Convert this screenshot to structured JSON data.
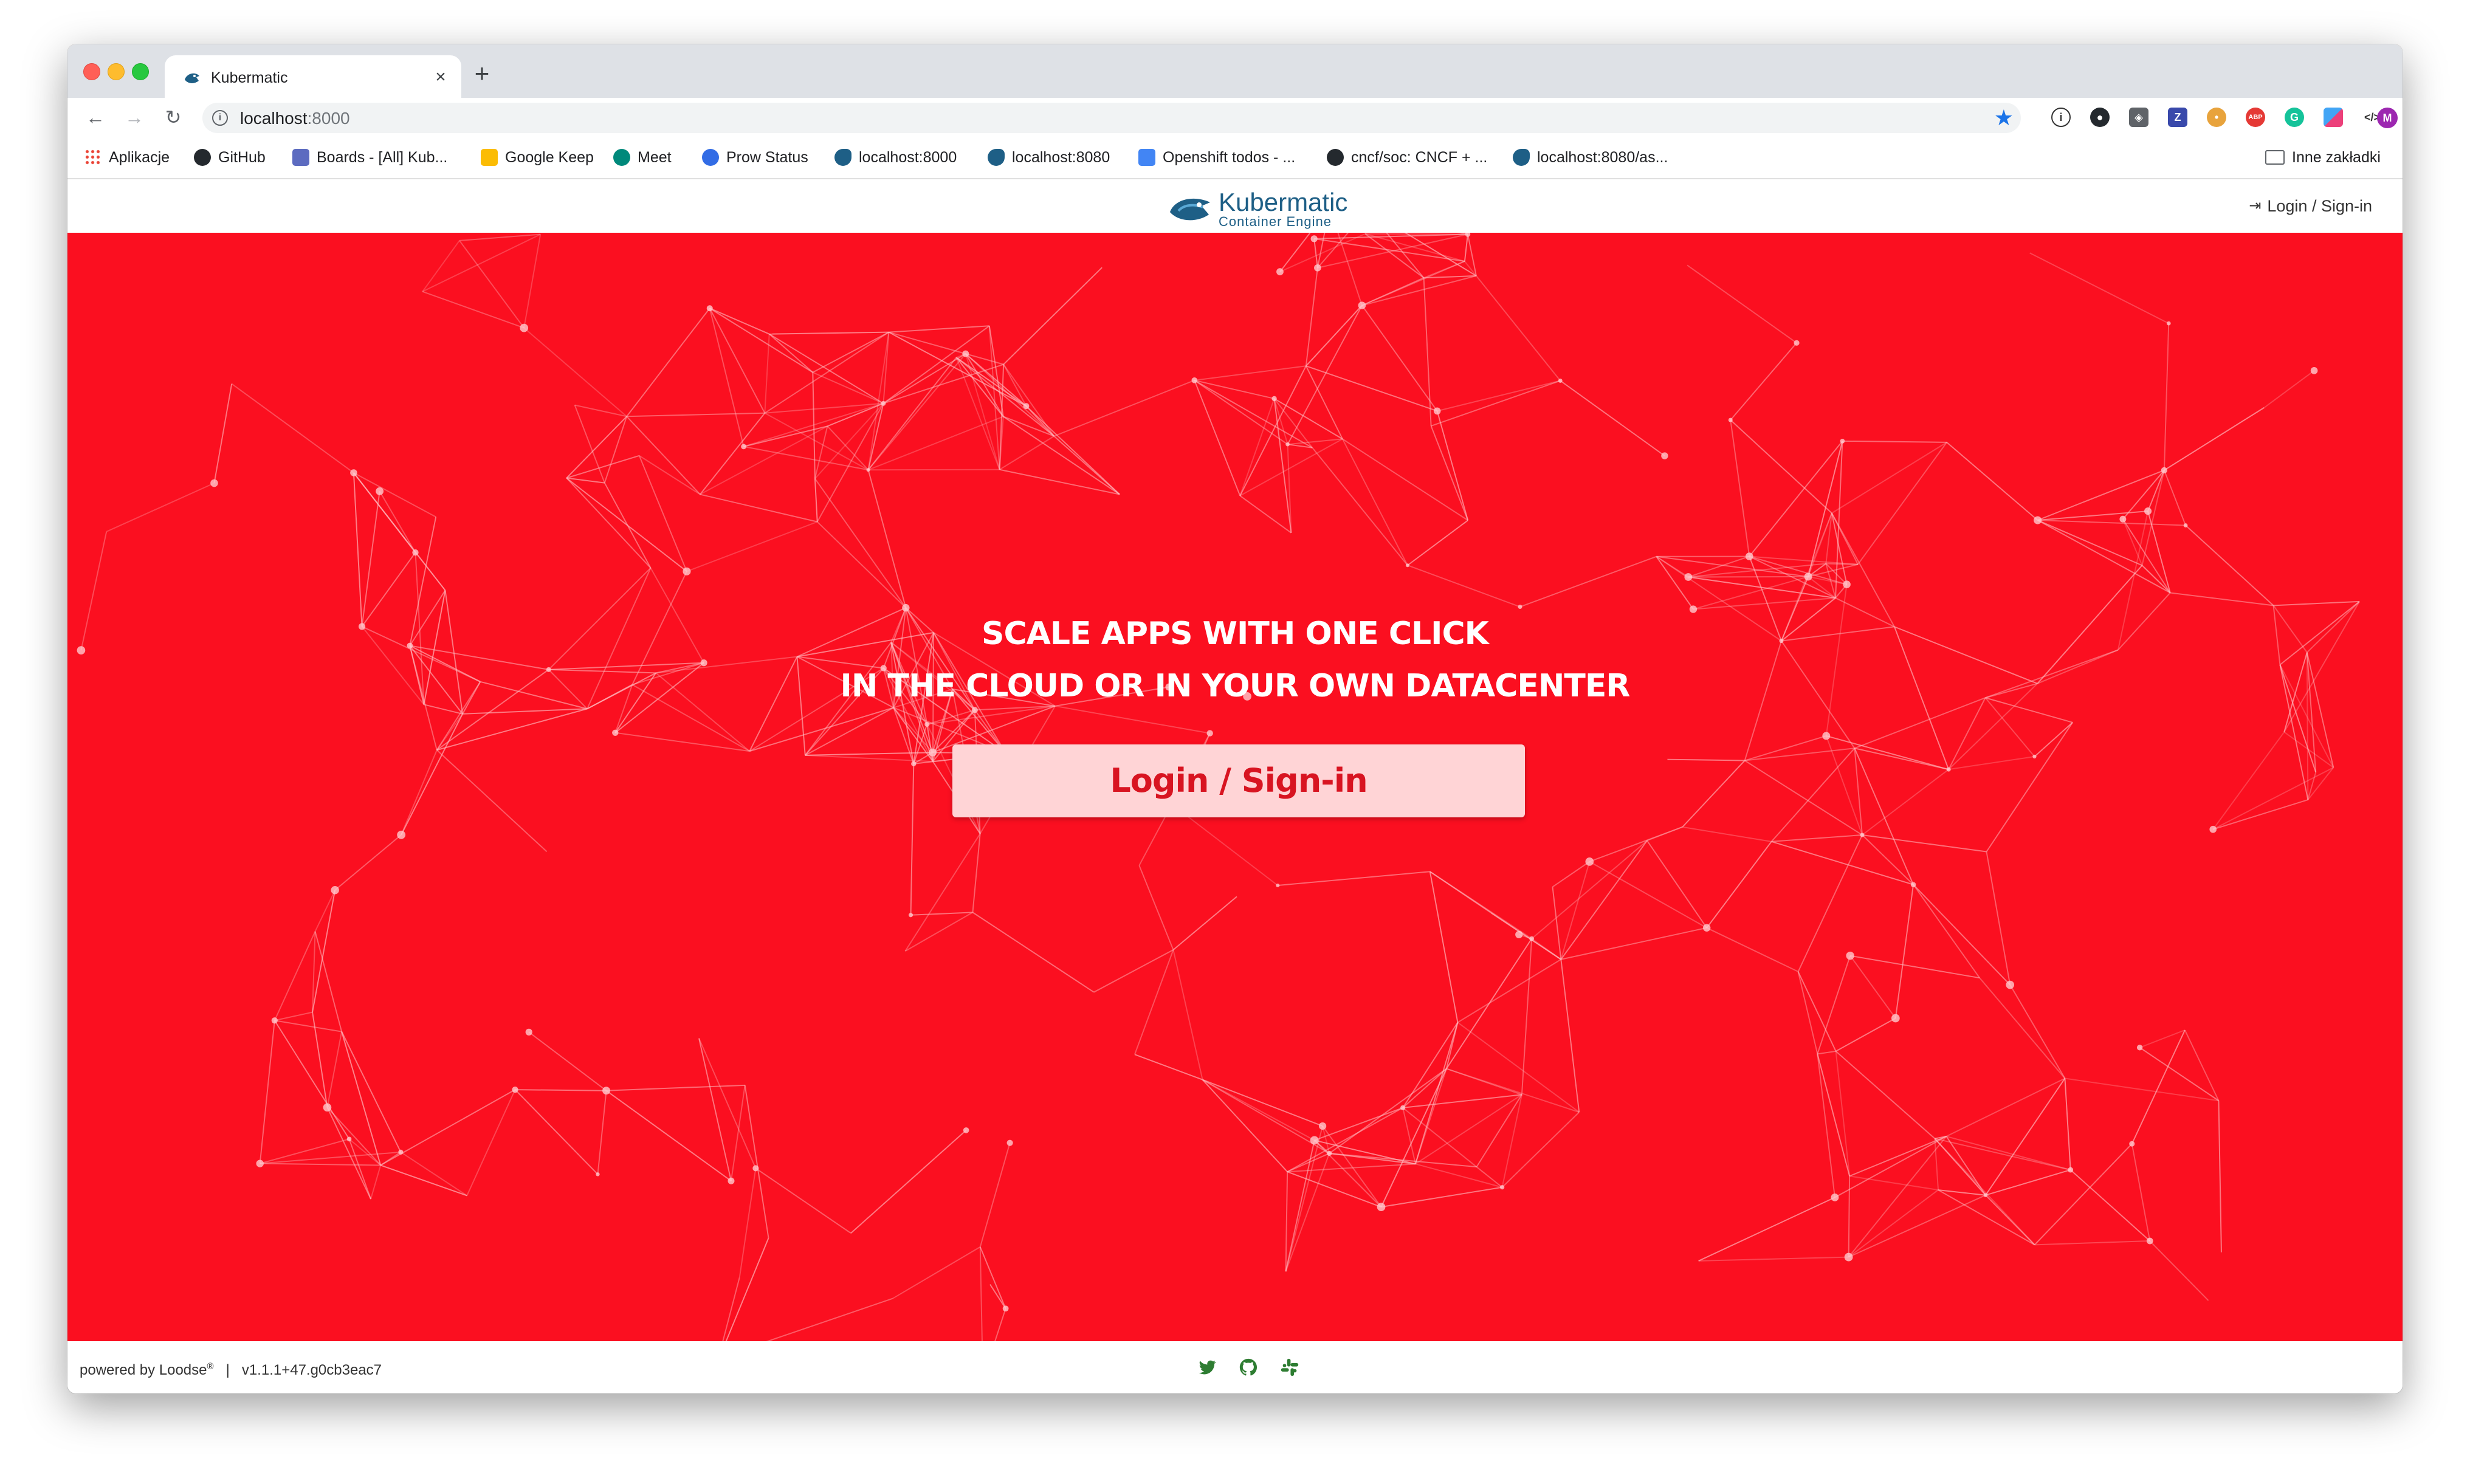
{
  "browser": {
    "tab_title": "Kubermatic",
    "url_host": "localhost",
    "url_port": ":8000",
    "extensions": [
      "1password-icon",
      "github-icon",
      "extension-icon",
      "zotero-icon",
      "cookie-icon",
      "adblock-icon",
      "grammarly-icon",
      "extension-icon",
      "code-icon"
    ],
    "profile_initial": "M",
    "bookmarks": [
      {
        "label": "Aplikacje",
        "icon": "apps-grid-icon"
      },
      {
        "label": "GitHub",
        "icon": "github-icon"
      },
      {
        "label": "Boards - [All] Kub...",
        "icon": "zenhub-icon"
      },
      {
        "label": "Google Keep",
        "icon": "keep-icon"
      },
      {
        "label": "Meet",
        "icon": "meet-icon"
      },
      {
        "label": "Prow Status",
        "icon": "kubernetes-icon"
      },
      {
        "label": "localhost:8000",
        "icon": "kubermatic-icon"
      },
      {
        "label": "localhost:8080",
        "icon": "kubermatic-icon"
      },
      {
        "label": "Openshift todos - ...",
        "icon": "docs-icon"
      },
      {
        "label": "cncf/soc: CNCF + ...",
        "icon": "github-icon"
      },
      {
        "label": "localhost:8080/as...",
        "icon": "kubermatic-icon"
      }
    ],
    "other_bookmarks": "Inne zakładki"
  },
  "header": {
    "brand_name": "Kubermatic",
    "brand_sub": "Container Engine",
    "login_label": "Login / Sign-in"
  },
  "hero": {
    "headline_1": "SCALE APPS WITH ONE CLICK",
    "headline_2": "IN THE CLOUD OR IN YOUR OWN DATACENTER",
    "cta_label": "Login / Sign-in",
    "background_color": "#fb0f20"
  },
  "footer": {
    "powered_by": "powered by",
    "powered_by_brand": "Loodse",
    "version": "v1.1.1+47.g0cb3eac7",
    "separator": "|",
    "icons": [
      "twitter-icon",
      "github-icon",
      "slack-icon"
    ],
    "icon_color": "#2e7d32"
  }
}
